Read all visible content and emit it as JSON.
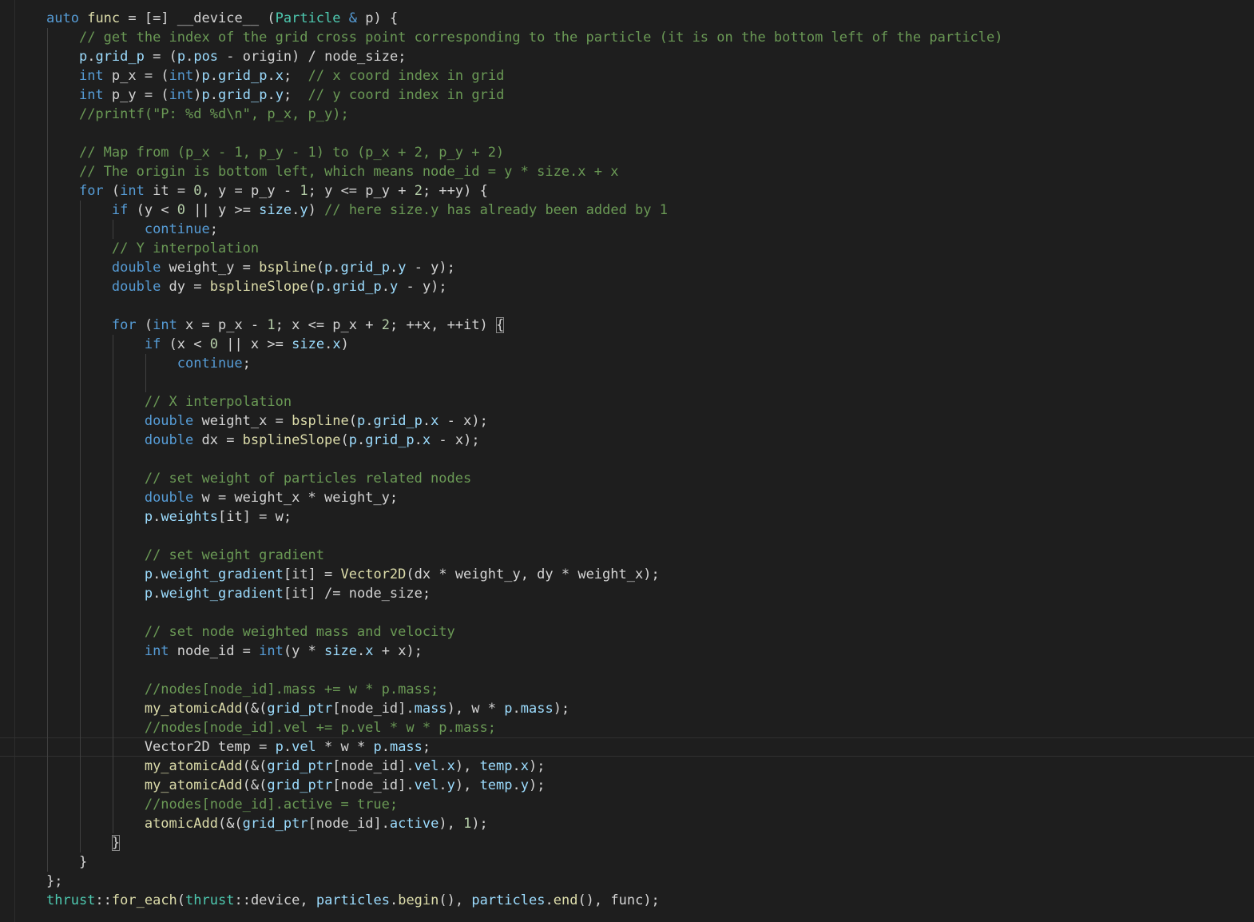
{
  "editor": {
    "theme_colors": {
      "background": "#1e1e1e",
      "keyword": "#569cd6",
      "function": "#dcdcaa",
      "type": "#4ec9b0",
      "variable": "#9cdcfe",
      "number": "#b5cea8",
      "string": "#ce9178",
      "comment": "#6a9955",
      "plain": "#d4d4d4"
    },
    "current_line": 38,
    "lines": [
      [
        [
          "kw",
          "auto"
        ],
        [
          "pl",
          " "
        ],
        [
          "fn",
          "func"
        ],
        [
          "pl",
          " = [=] __device__ ("
        ],
        [
          "ty",
          "Particle"
        ],
        [
          "pl",
          " "
        ],
        [
          "kw",
          "&"
        ],
        [
          "pl",
          " p) {"
        ]
      ],
      [
        [
          "pl",
          "    "
        ],
        [
          "com",
          "// get the index of the grid cross point corresponding to the particle (it is on the bottom left of the particle)"
        ]
      ],
      [
        [
          "pl",
          "    "
        ],
        [
          "var",
          "p"
        ],
        [
          "pl",
          "."
        ],
        [
          "var",
          "grid_p"
        ],
        [
          "pl",
          " = ("
        ],
        [
          "var",
          "p"
        ],
        [
          "pl",
          "."
        ],
        [
          "var",
          "pos"
        ],
        [
          "pl",
          " - origin) / node_size;"
        ]
      ],
      [
        [
          "pl",
          "    "
        ],
        [
          "kw",
          "int"
        ],
        [
          "pl",
          " p_x = ("
        ],
        [
          "kw",
          "int"
        ],
        [
          "pl",
          ")"
        ],
        [
          "var",
          "p"
        ],
        [
          "pl",
          "."
        ],
        [
          "var",
          "grid_p"
        ],
        [
          "pl",
          "."
        ],
        [
          "var",
          "x"
        ],
        [
          "pl",
          ";  "
        ],
        [
          "com",
          "// x coord index in grid"
        ]
      ],
      [
        [
          "pl",
          "    "
        ],
        [
          "kw",
          "int"
        ],
        [
          "pl",
          " p_y = ("
        ],
        [
          "kw",
          "int"
        ],
        [
          "pl",
          ")"
        ],
        [
          "var",
          "p"
        ],
        [
          "pl",
          "."
        ],
        [
          "var",
          "grid_p"
        ],
        [
          "pl",
          "."
        ],
        [
          "var",
          "y"
        ],
        [
          "pl",
          ";  "
        ],
        [
          "com",
          "// y coord index in grid"
        ]
      ],
      [
        [
          "pl",
          "    "
        ],
        [
          "com",
          "//printf(\"P: %d %d\\n\", p_x, p_y);"
        ]
      ],
      [],
      [
        [
          "pl",
          "    "
        ],
        [
          "com",
          "// Map from (p_x - 1, p_y - 1) to (p_x + 2, p_y + 2)"
        ]
      ],
      [
        [
          "pl",
          "    "
        ],
        [
          "com",
          "// The origin is bottom left, which means node_id = y * size.x + x"
        ]
      ],
      [
        [
          "pl",
          "    "
        ],
        [
          "kw",
          "for"
        ],
        [
          "pl",
          " ("
        ],
        [
          "kw",
          "int"
        ],
        [
          "pl",
          " it = "
        ],
        [
          "num",
          "0"
        ],
        [
          "pl",
          ", y = p_y - "
        ],
        [
          "num",
          "1"
        ],
        [
          "pl",
          "; y <= p_y + "
        ],
        [
          "num",
          "2"
        ],
        [
          "pl",
          "; ++y) {"
        ]
      ],
      [
        [
          "pl",
          "        "
        ],
        [
          "kw",
          "if"
        ],
        [
          "pl",
          " (y < "
        ],
        [
          "num",
          "0"
        ],
        [
          "pl",
          " || y >= "
        ],
        [
          "var",
          "size"
        ],
        [
          "pl",
          "."
        ],
        [
          "var",
          "y"
        ],
        [
          "pl",
          ") "
        ],
        [
          "com",
          "// here size.y has already been added by 1"
        ]
      ],
      [
        [
          "pl",
          "            "
        ],
        [
          "kw",
          "continue"
        ],
        [
          "pl",
          ";"
        ]
      ],
      [
        [
          "pl",
          "        "
        ],
        [
          "com",
          "// Y interpolation"
        ]
      ],
      [
        [
          "pl",
          "        "
        ],
        [
          "kw",
          "double"
        ],
        [
          "pl",
          " weight_y = "
        ],
        [
          "fn",
          "bspline"
        ],
        [
          "pl",
          "("
        ],
        [
          "var",
          "p"
        ],
        [
          "pl",
          "."
        ],
        [
          "var",
          "grid_p"
        ],
        [
          "pl",
          "."
        ],
        [
          "var",
          "y"
        ],
        [
          "pl",
          " - y);"
        ]
      ],
      [
        [
          "pl",
          "        "
        ],
        [
          "kw",
          "double"
        ],
        [
          "pl",
          " dy = "
        ],
        [
          "fn",
          "bsplineSlope"
        ],
        [
          "pl",
          "("
        ],
        [
          "var",
          "p"
        ],
        [
          "pl",
          "."
        ],
        [
          "var",
          "grid_p"
        ],
        [
          "pl",
          "."
        ],
        [
          "var",
          "y"
        ],
        [
          "pl",
          " - y);"
        ]
      ],
      [],
      [
        [
          "pl",
          "        "
        ],
        [
          "kw",
          "for"
        ],
        [
          "pl",
          " ("
        ],
        [
          "kw",
          "int"
        ],
        [
          "pl",
          " x = p_x - "
        ],
        [
          "num",
          "1"
        ],
        [
          "pl",
          "; x <= p_x + "
        ],
        [
          "num",
          "2"
        ],
        [
          "pl",
          "; ++x, ++it) "
        ],
        [
          "bm",
          "{"
        ]
      ],
      [
        [
          "pl",
          "            "
        ],
        [
          "kw",
          "if"
        ],
        [
          "pl",
          " (x < "
        ],
        [
          "num",
          "0"
        ],
        [
          "pl",
          " || x >= "
        ],
        [
          "var",
          "size"
        ],
        [
          "pl",
          "."
        ],
        [
          "var",
          "x"
        ],
        [
          "pl",
          ")"
        ]
      ],
      [
        [
          "pl",
          "                "
        ],
        [
          "kw",
          "continue"
        ],
        [
          "pl",
          ";"
        ]
      ],
      [],
      [
        [
          "pl",
          "            "
        ],
        [
          "com",
          "// X interpolation"
        ]
      ],
      [
        [
          "pl",
          "            "
        ],
        [
          "kw",
          "double"
        ],
        [
          "pl",
          " weight_x = "
        ],
        [
          "fn",
          "bspline"
        ],
        [
          "pl",
          "("
        ],
        [
          "var",
          "p"
        ],
        [
          "pl",
          "."
        ],
        [
          "var",
          "grid_p"
        ],
        [
          "pl",
          "."
        ],
        [
          "var",
          "x"
        ],
        [
          "pl",
          " - x);"
        ]
      ],
      [
        [
          "pl",
          "            "
        ],
        [
          "kw",
          "double"
        ],
        [
          "pl",
          " dx = "
        ],
        [
          "fn",
          "bsplineSlope"
        ],
        [
          "pl",
          "("
        ],
        [
          "var",
          "p"
        ],
        [
          "pl",
          "."
        ],
        [
          "var",
          "grid_p"
        ],
        [
          "pl",
          "."
        ],
        [
          "var",
          "x"
        ],
        [
          "pl",
          " - x);"
        ]
      ],
      [],
      [
        [
          "pl",
          "            "
        ],
        [
          "com",
          "// set weight of particles related nodes"
        ]
      ],
      [
        [
          "pl",
          "            "
        ],
        [
          "kw",
          "double"
        ],
        [
          "pl",
          " w = weight_x * weight_y;"
        ]
      ],
      [
        [
          "pl",
          "            "
        ],
        [
          "var",
          "p"
        ],
        [
          "pl",
          "."
        ],
        [
          "var",
          "weights"
        ],
        [
          "pl",
          "[it] = w;"
        ]
      ],
      [],
      [
        [
          "pl",
          "            "
        ],
        [
          "com",
          "// set weight gradient"
        ]
      ],
      [
        [
          "pl",
          "            "
        ],
        [
          "var",
          "p"
        ],
        [
          "pl",
          "."
        ],
        [
          "var",
          "weight_gradient"
        ],
        [
          "pl",
          "[it] = "
        ],
        [
          "fn",
          "Vector2D"
        ],
        [
          "pl",
          "(dx * weight_y, dy * weight_x);"
        ]
      ],
      [
        [
          "pl",
          "            "
        ],
        [
          "var",
          "p"
        ],
        [
          "pl",
          "."
        ],
        [
          "var",
          "weight_gradient"
        ],
        [
          "pl",
          "[it] /= node_size;"
        ]
      ],
      [],
      [
        [
          "pl",
          "            "
        ],
        [
          "com",
          "// set node weighted mass and velocity"
        ]
      ],
      [
        [
          "pl",
          "            "
        ],
        [
          "kw",
          "int"
        ],
        [
          "pl",
          " node_id = "
        ],
        [
          "kw",
          "int"
        ],
        [
          "pl",
          "(y * "
        ],
        [
          "var",
          "size"
        ],
        [
          "pl",
          "."
        ],
        [
          "var",
          "x"
        ],
        [
          "pl",
          " + x);"
        ]
      ],
      [],
      [
        [
          "pl",
          "            "
        ],
        [
          "com",
          "//nodes[node_id].mass += w * p.mass;"
        ]
      ],
      [
        [
          "pl",
          "            "
        ],
        [
          "fn",
          "my_atomicAdd"
        ],
        [
          "pl",
          "(&("
        ],
        [
          "var",
          "grid_ptr"
        ],
        [
          "pl",
          "[node_id]."
        ],
        [
          "var",
          "mass"
        ],
        [
          "pl",
          "), w * "
        ],
        [
          "var",
          "p"
        ],
        [
          "pl",
          "."
        ],
        [
          "var",
          "mass"
        ],
        [
          "pl",
          ");"
        ]
      ],
      [
        [
          "pl",
          "            "
        ],
        [
          "com",
          "//nodes[node_id].vel += p.vel * w * p.mass;"
        ]
      ],
      [
        [
          "pl",
          "            Vector2D temp = "
        ],
        [
          "var",
          "p"
        ],
        [
          "pl",
          "."
        ],
        [
          "var",
          "vel"
        ],
        [
          "pl",
          " * w * "
        ],
        [
          "var",
          "p"
        ],
        [
          "pl",
          "."
        ],
        [
          "var",
          "mass"
        ],
        [
          "pl",
          ";"
        ]
      ],
      [
        [
          "pl",
          "            "
        ],
        [
          "fn",
          "my_atomicAdd"
        ],
        [
          "pl",
          "(&("
        ],
        [
          "var",
          "grid_ptr"
        ],
        [
          "pl",
          "[node_id]."
        ],
        [
          "var",
          "vel"
        ],
        [
          "pl",
          "."
        ],
        [
          "var",
          "x"
        ],
        [
          "pl",
          "), "
        ],
        [
          "var",
          "temp"
        ],
        [
          "pl",
          "."
        ],
        [
          "var",
          "x"
        ],
        [
          "pl",
          ");"
        ]
      ],
      [
        [
          "pl",
          "            "
        ],
        [
          "fn",
          "my_atomicAdd"
        ],
        [
          "pl",
          "(&("
        ],
        [
          "var",
          "grid_ptr"
        ],
        [
          "pl",
          "[node_id]."
        ],
        [
          "var",
          "vel"
        ],
        [
          "pl",
          "."
        ],
        [
          "var",
          "y"
        ],
        [
          "pl",
          "), "
        ],
        [
          "var",
          "temp"
        ],
        [
          "pl",
          "."
        ],
        [
          "var",
          "y"
        ],
        [
          "pl",
          ");"
        ]
      ],
      [
        [
          "pl",
          "            "
        ],
        [
          "com",
          "//nodes[node_id].active = true;"
        ]
      ],
      [
        [
          "pl",
          "            "
        ],
        [
          "fn",
          "atomicAdd"
        ],
        [
          "pl",
          "(&("
        ],
        [
          "var",
          "grid_ptr"
        ],
        [
          "pl",
          "[node_id]."
        ],
        [
          "var",
          "active"
        ],
        [
          "pl",
          "), "
        ],
        [
          "num",
          "1"
        ],
        [
          "pl",
          ");"
        ]
      ],
      [
        [
          "pl",
          "        "
        ],
        [
          "bm",
          "}"
        ]
      ],
      [
        [
          "pl",
          "    }"
        ]
      ],
      [
        [
          "pl",
          "};"
        ]
      ],
      [
        [
          "ty",
          "thrust"
        ],
        [
          "pl",
          "::"
        ],
        [
          "fn",
          "for_each"
        ],
        [
          "pl",
          "("
        ],
        [
          "ty",
          "thrust"
        ],
        [
          "pl",
          "::device, "
        ],
        [
          "var",
          "particles"
        ],
        [
          "pl",
          "."
        ],
        [
          "fn",
          "begin"
        ],
        [
          "pl",
          "(), "
        ],
        [
          "var",
          "particles"
        ],
        [
          "pl",
          "."
        ],
        [
          "fn",
          "end"
        ],
        [
          "pl",
          "(), func);"
        ]
      ]
    ],
    "guides": [
      [],
      [
        0
      ],
      [
        0
      ],
      [
        0
      ],
      [
        0
      ],
      [
        0
      ],
      [
        0
      ],
      [
        0
      ],
      [
        0
      ],
      [
        0
      ],
      [
        0,
        1
      ],
      [
        0,
        1,
        2
      ],
      [
        0,
        1
      ],
      [
        0,
        1
      ],
      [
        0,
        1
      ],
      [
        0,
        1
      ],
      [
        0,
        1
      ],
      [
        0,
        1,
        2
      ],
      [
        0,
        1,
        2,
        3
      ],
      [
        0,
        1,
        2,
        3
      ],
      [
        0,
        1,
        2
      ],
      [
        0,
        1,
        2
      ],
      [
        0,
        1,
        2
      ],
      [
        0,
        1,
        2
      ],
      [
        0,
        1,
        2
      ],
      [
        0,
        1,
        2
      ],
      [
        0,
        1,
        2
      ],
      [
        0,
        1,
        2
      ],
      [
        0,
        1,
        2
      ],
      [
        0,
        1,
        2
      ],
      [
        0,
        1,
        2
      ],
      [
        0,
        1,
        2
      ],
      [
        0,
        1,
        2
      ],
      [
        0,
        1,
        2
      ],
      [
        0,
        1,
        2
      ],
      [
        0,
        1,
        2
      ],
      [
        0,
        1,
        2
      ],
      [
        0,
        1,
        2
      ],
      [
        0,
        1,
        2
      ],
      [
        0,
        1,
        2
      ],
      [
        0,
        1,
        2
      ],
      [
        0,
        1,
        2
      ],
      [
        0,
        1,
        2
      ],
      [
        0,
        1
      ],
      [
        0
      ],
      [],
      []
    ]
  }
}
